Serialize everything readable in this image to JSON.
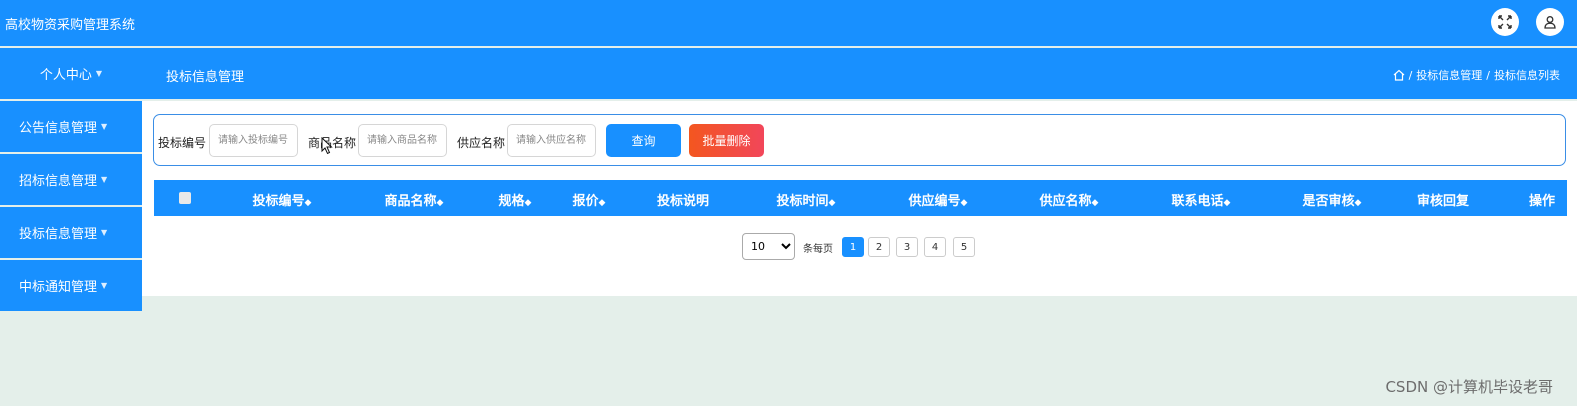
{
  "header": {
    "app_title": "高校物资采购管理系统",
    "icons": [
      "fullscreen-icon",
      "user-icon"
    ]
  },
  "navbar": {
    "user_menu": "个人中心",
    "page_title": "投标信息管理",
    "breadcrumb": [
      "投标信息管理",
      "投标信息列表"
    ],
    "breadcrumb_sep": "/"
  },
  "sidebar": {
    "items": [
      {
        "label": "公告信息管理"
      },
      {
        "label": "招标信息管理"
      },
      {
        "label": "投标信息管理"
      },
      {
        "label": "中标通知管理"
      }
    ]
  },
  "search": {
    "fields": [
      {
        "label": "投标编号",
        "placeholder": "请输入投标编号",
        "value": ""
      },
      {
        "label": "商品名称",
        "placeholder": "请输入商品名称",
        "value": ""
      },
      {
        "label": "供应名称",
        "placeholder": "请输入供应名称",
        "value": ""
      }
    ],
    "query_label": "查询",
    "batch_delete_label": "批量删除"
  },
  "table": {
    "columns": [
      {
        "label": "投标编号",
        "sortable": true
      },
      {
        "label": "商品名称",
        "sortable": true
      },
      {
        "label": "规格",
        "sortable": true
      },
      {
        "label": "报价",
        "sortable": true
      },
      {
        "label": "投标说明",
        "sortable": false
      },
      {
        "label": "投标时间",
        "sortable": true
      },
      {
        "label": "供应编号",
        "sortable": true
      },
      {
        "label": "供应名称",
        "sortable": true
      },
      {
        "label": "联系电话",
        "sortable": true
      },
      {
        "label": "是否审核",
        "sortable": true
      },
      {
        "label": "审核回复",
        "sortable": false
      },
      {
        "label": "操作",
        "sortable": false
      }
    ],
    "rows": []
  },
  "pagination": {
    "page_size": "10",
    "per_page_label": "条每页",
    "pages": [
      "1",
      "2",
      "3",
      "4",
      "5"
    ],
    "current_page": "1"
  },
  "watermark": "CSDN @计算机毕设老哥",
  "colors": {
    "primary": "#1890ff",
    "danger": "#f2553c",
    "background": "#e4efea"
  }
}
